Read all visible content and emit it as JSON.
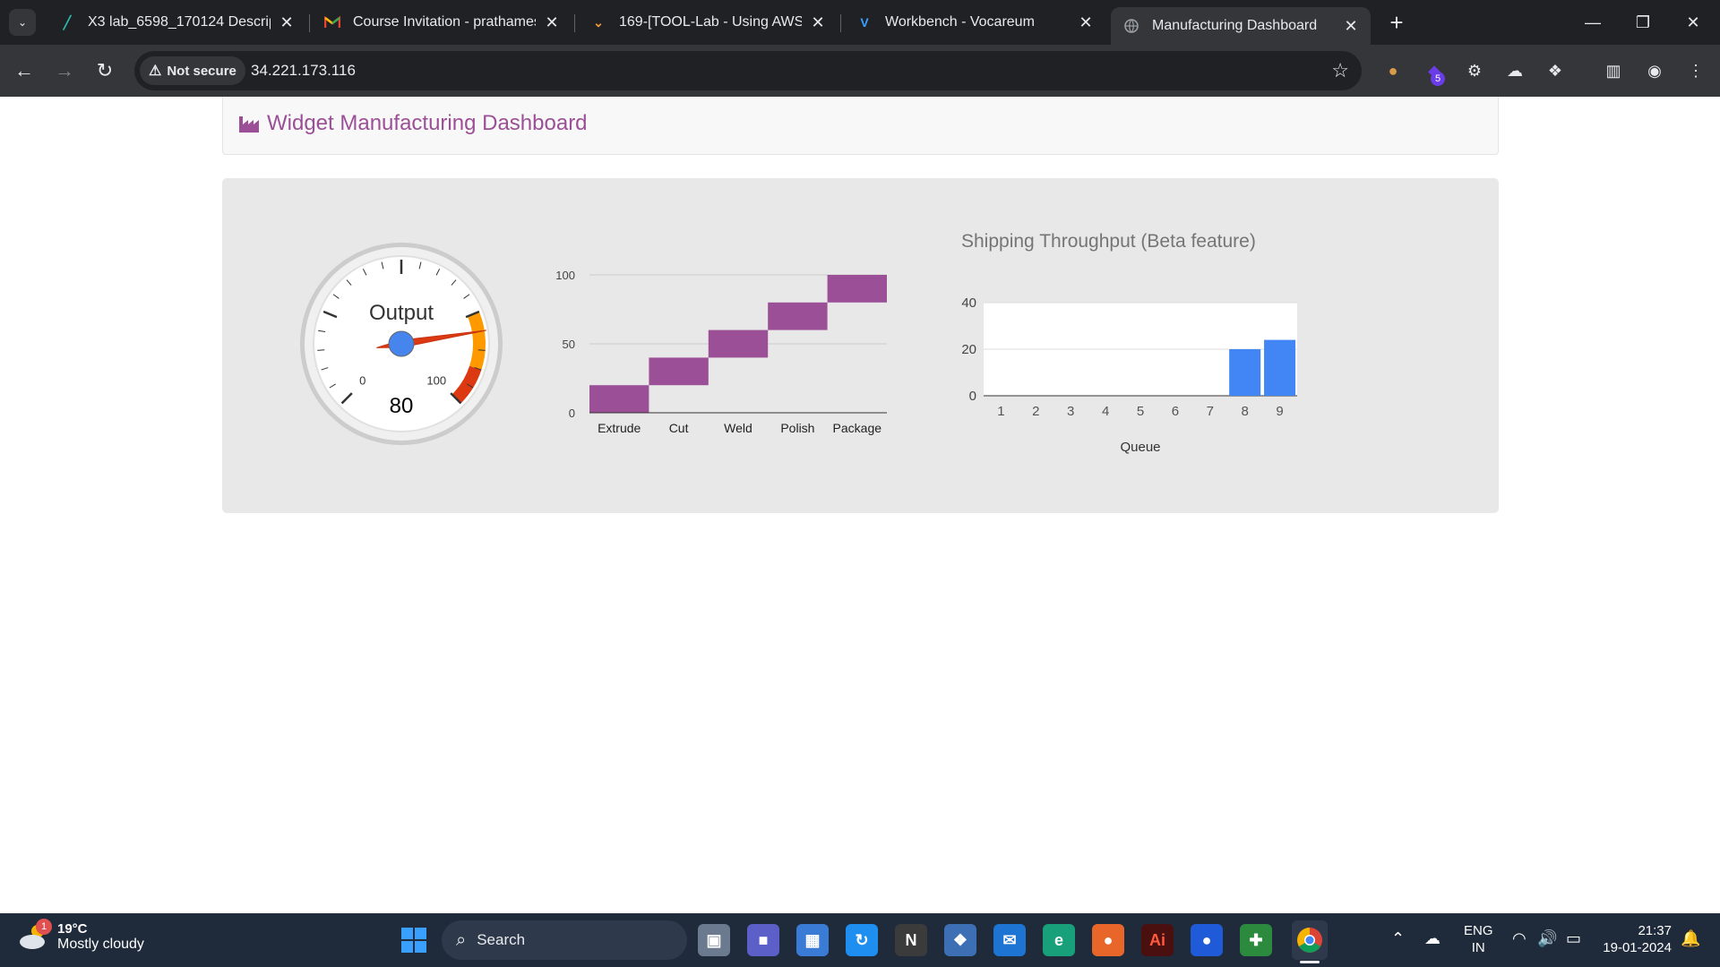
{
  "browser": {
    "tabs": [
      {
        "title": "X3 lab_6598_170124 Descriptio",
        "icon": "leaf-icon",
        "active": false
      },
      {
        "title": "Course Invitation - prathamesh",
        "icon": "gmail-icon",
        "active": false
      },
      {
        "title": "169-[TOOL-Lab - Using AWS Sy",
        "icon": "vocareum-doc-icon",
        "active": false
      },
      {
        "title": "Workbench - Vocareum",
        "icon": "vocareum-icon",
        "active": false
      },
      {
        "title": "Manufacturing Dashboard",
        "icon": "globe-icon",
        "active": true
      }
    ],
    "security_label": "Not secure",
    "url": "34.221.173.116",
    "extension_badge": "5"
  },
  "page": {
    "title": "Widget Manufacturing Dashboard",
    "accent_color": "#9b4f96"
  },
  "gauge": {
    "label": "Output",
    "value": 80,
    "min_label": "0",
    "max_label": "100",
    "min": 0,
    "max": 100,
    "yellow_from": 75,
    "red_from": 90
  },
  "chart_data": [
    {
      "type": "bar",
      "title": "",
      "categories": [
        "Extrude",
        "Cut",
        "Weld",
        "Polish",
        "Package"
      ],
      "series": [
        {
          "ranges": [
            [
              0,
              20
            ],
            [
              20,
              40
            ],
            [
              40,
              60
            ],
            [
              60,
              80
            ],
            [
              80,
              100
            ]
          ]
        }
      ],
      "y_ticks": [
        "0",
        "50",
        "100"
      ],
      "ylim": [
        0,
        100
      ],
      "color": "#9b4f96",
      "grid": true
    },
    {
      "type": "bar",
      "title": "Shipping Throughput (Beta feature)",
      "xlabel": "Queue",
      "categories": [
        "1",
        "2",
        "3",
        "4",
        "5",
        "6",
        "7",
        "8",
        "9"
      ],
      "values": [
        0,
        0,
        0,
        0,
        0,
        0,
        0,
        20,
        24
      ],
      "y_ticks": [
        "0",
        "20",
        "40"
      ],
      "ylim": [
        0,
        40
      ],
      "color": "#4285f4",
      "grid": true
    }
  ],
  "taskbar": {
    "weather_temp": "19°C",
    "weather_condition": "Mostly cloudy",
    "weather_badge": "1",
    "search_label": "Search",
    "lang_line1": "ENG",
    "lang_line2": "IN",
    "time": "21:37",
    "date": "19-01-2024"
  }
}
